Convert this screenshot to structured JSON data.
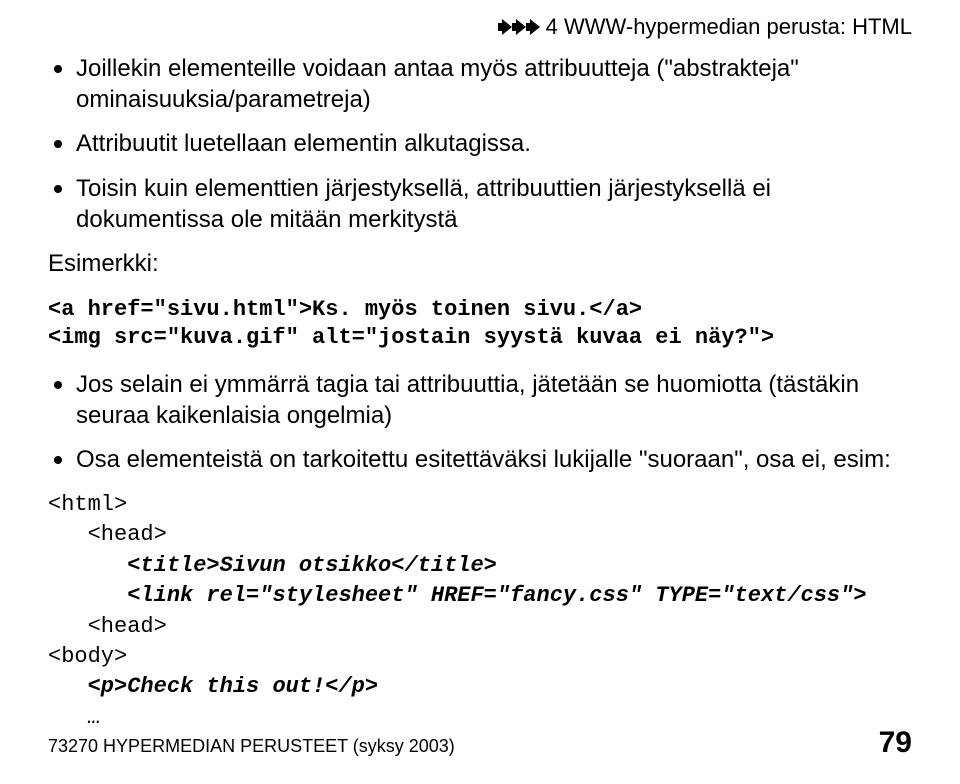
{
  "header": {
    "section": "4 WWW-hypermedian perusta: HTML"
  },
  "bullets": {
    "b1": "Joillekin elementeille voidaan antaa myös attribuutteja (\"abstrakteja\" ominaisuuksia/parametreja)",
    "b2": "Attribuutit luetellaan elementin alkutagissa.",
    "b3": "Toisin kuin elementtien järjestyksellä, attribuuttien järjestyksellä ei dokumentissa ole mitään merkitystä",
    "b4": "Jos selain ei ymmärrä tagia tai attribuuttia, jätetään se huomiotta (tästäkin seuraa kaikenlaisia ongelmia)",
    "b5": "Osa elementeistä on tarkoitettu esitettäväksi lukijalle \"suoraan\", osa ei, esim:"
  },
  "labels": {
    "esimerkki": "Esimerkki:"
  },
  "code1": "<a href=\"sivu.html\">Ks. myös toinen sivu.</a>\n<img src=\"kuva.gif\" alt=\"jostain syystä kuvaa ei näy?\">",
  "code2": {
    "l1": "<html>",
    "l2": "   <head>",
    "l3a": "      ",
    "l3b": "<title>Sivun otsikko</title>",
    "l4a": "      ",
    "l4b": "<link rel=\"stylesheet\" HREF=\"fancy.css\" TYPE=\"text/css\">",
    "l5": "   <head>",
    "l6": "<body>",
    "l7a": "   ",
    "l7b": "<p>Check this out!</p>",
    "l8a": "   ",
    "l8b": "…"
  },
  "footer": {
    "course": "73270 HYPERMEDIAN PERUSTEET (syksy 2003)",
    "page": "79"
  }
}
